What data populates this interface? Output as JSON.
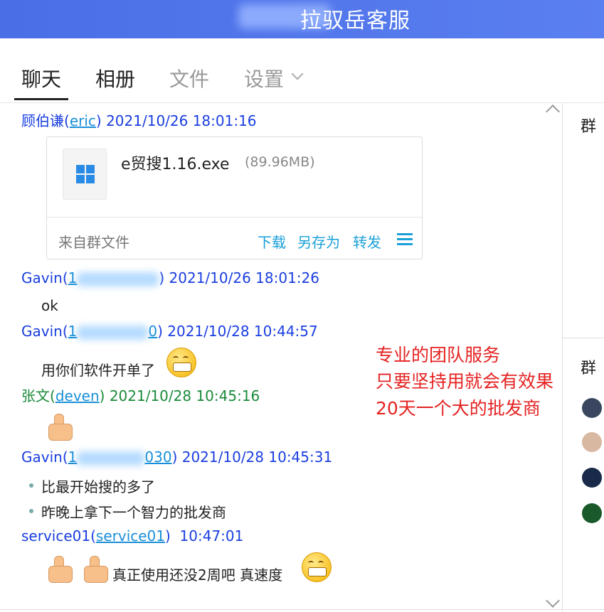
{
  "window": {
    "title": "拉驭岳客服"
  },
  "tabs": [
    {
      "label": "聊天"
    },
    {
      "label": "相册"
    },
    {
      "label": "文件"
    },
    {
      "label": "设置"
    }
  ],
  "messages": [
    {
      "sender": "顾伯谦",
      "id": "eric",
      "time": "2021/10/26 18:01:16"
    },
    {
      "sender": "Gavin",
      "id": "1",
      "time": "2021/10/26 18:01:26",
      "text": "ok"
    },
    {
      "sender": "Gavin",
      "id": "1",
      "id_tail": "0",
      "time": "2021/10/28 10:44:57",
      "text": "用你们软件开单了"
    },
    {
      "sender": "张文",
      "id": "deven",
      "time": "2021/10/28 10:45:16"
    },
    {
      "sender": "Gavin",
      "id": "1",
      "id_tail": "030",
      "time": "2021/10/28 10:45:31",
      "bullets": [
        "比最开始搜的多了",
        "昨晚上拿下一个智力的批发商"
      ]
    },
    {
      "sender": "service01",
      "id": "service01",
      "time": "10:47:01",
      "text": "真正使用还没2周吧  真速度"
    }
  ],
  "file_card": {
    "name": "e贸搜1.16.exe",
    "size": "(89.96MB)",
    "source": "来自群文件",
    "actions": [
      "下载",
      "另存为",
      "转发"
    ]
  },
  "promo_lines": [
    "专业的团队服务",
    "只要坚持用就会有效果",
    "20天一个大的批发商"
  ],
  "sidebar": {
    "label_top": "群",
    "label_bottom": "群"
  }
}
